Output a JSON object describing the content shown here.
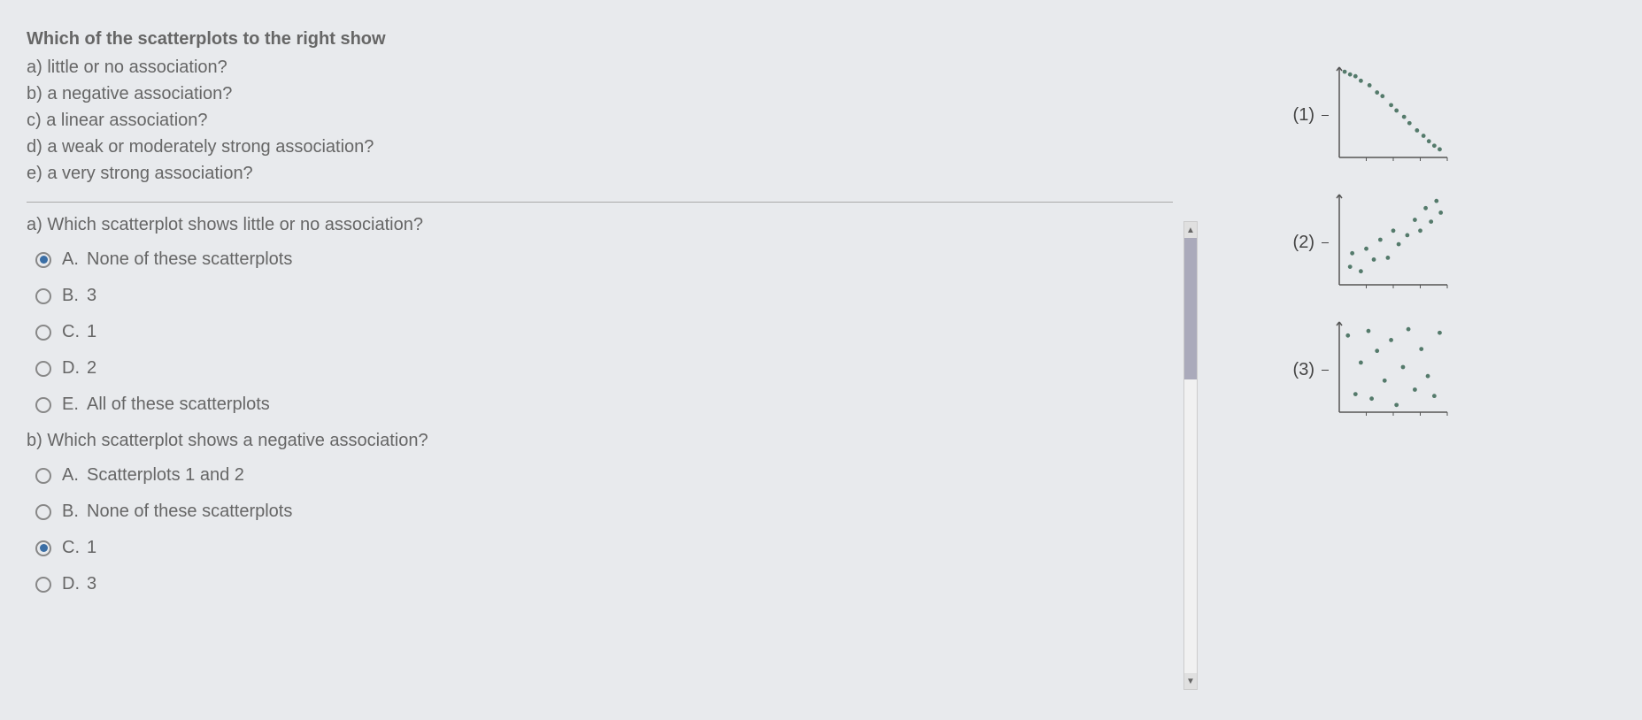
{
  "header": {
    "prompt": "Which of the scatterplots to the right show",
    "parts": [
      "a) little or no association?",
      "b) a negative association?",
      "c) a linear association?",
      "d) a weak or moderately strong association?",
      "e) a very strong association?"
    ]
  },
  "sections": [
    {
      "title": "a) Which scatterplot shows little or no association?",
      "options": [
        {
          "letter": "A.",
          "text": "None of these scatterplots",
          "selected": true
        },
        {
          "letter": "B.",
          "text": "3",
          "selected": false
        },
        {
          "letter": "C.",
          "text": "1",
          "selected": false
        },
        {
          "letter": "D.",
          "text": "2",
          "selected": false
        },
        {
          "letter": "E.",
          "text": "All of these scatterplots",
          "selected": false
        }
      ]
    },
    {
      "title": "b) Which scatterplot shows a negative association?",
      "options": [
        {
          "letter": "A.",
          "text": "Scatterplots 1 and 2",
          "selected": false
        },
        {
          "letter": "B.",
          "text": "None of these scatterplots",
          "selected": false
        },
        {
          "letter": "C.",
          "text": "1",
          "selected": true
        },
        {
          "letter": "D.",
          "text": "3",
          "selected": false
        }
      ]
    }
  ],
  "charts": [
    {
      "label": "(1)"
    },
    {
      "label": "(2)"
    },
    {
      "label": "(3)"
    }
  ],
  "chart_data": [
    {
      "type": "scatter",
      "title": "(1)",
      "xlim": [
        0,
        10
      ],
      "ylim": [
        0,
        10
      ],
      "x": [
        0.5,
        1.0,
        1.5,
        2.0,
        2.8,
        3.5,
        4.0,
        4.8,
        5.3,
        6.0,
        6.5,
        7.2,
        7.8,
        8.3,
        8.8,
        9.3
      ],
      "y": [
        9.5,
        9.2,
        9.0,
        8.5,
        8.0,
        7.2,
        6.8,
        5.8,
        5.2,
        4.5,
        3.8,
        3.0,
        2.4,
        1.8,
        1.3,
        0.9
      ]
    },
    {
      "type": "scatter",
      "title": "(2)",
      "xlim": [
        0,
        10
      ],
      "ylim": [
        0,
        10
      ],
      "x": [
        1.0,
        1.2,
        2.0,
        2.5,
        3.2,
        3.8,
        4.5,
        5.0,
        5.5,
        6.3,
        7.0,
        7.5,
        8.0,
        8.5,
        9.0,
        9.4
      ],
      "y": [
        2.0,
        3.5,
        1.5,
        4.0,
        2.8,
        5.0,
        3.0,
        6.0,
        4.5,
        5.5,
        7.2,
        6.0,
        8.5,
        7.0,
        9.3,
        8.0
      ]
    },
    {
      "type": "scatter",
      "title": "(3)",
      "xlim": [
        0,
        10
      ],
      "ylim": [
        0,
        10
      ],
      "x": [
        0.8,
        1.5,
        2.0,
        2.7,
        3.0,
        3.5,
        4.2,
        4.8,
        5.3,
        5.9,
        6.4,
        7.0,
        7.6,
        8.2,
        8.8,
        9.3
      ],
      "y": [
        8.5,
        2.0,
        5.5,
        9.0,
        1.5,
        6.8,
        3.5,
        8.0,
        0.8,
        5.0,
        9.2,
        2.5,
        7.0,
        4.0,
        1.8,
        8.8
      ]
    }
  ]
}
